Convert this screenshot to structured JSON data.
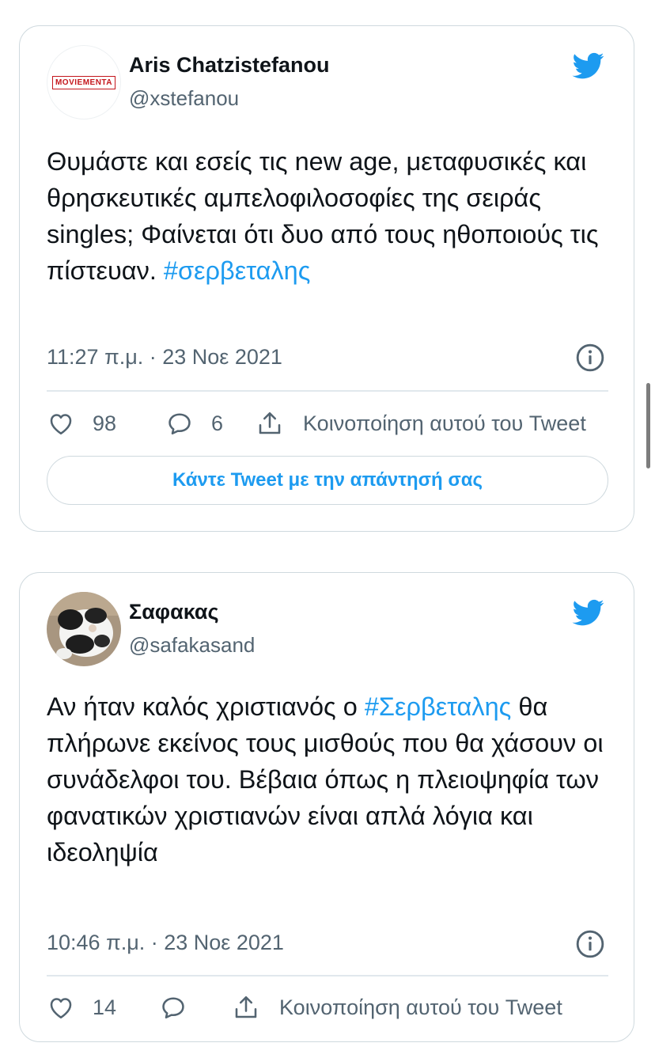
{
  "tweets": [
    {
      "author_name": "Aris Chatzistefanou",
      "handle": "@xstefanou",
      "avatar_logo_text": "MOVIEMENTA",
      "text_plain": "Θυμάστε και εσείς τις new age, μεταφυσικές και θρησκευτικές αμπελοφιλοσοφίες της σειράς singles; Φαίνεται ότι δυο από τους ηθοποιούς τις πίστευαν. ",
      "hashtag": "#σερβεταλης",
      "timestamp": "11:27 π.μ. · 23 Νοε 2021",
      "likes": "98",
      "replies": "6",
      "share_label": "Κοινοποίηση αυτού του Tweet",
      "reply_prompt": "Κάντε Tweet με την απάντησή σας"
    },
    {
      "author_name": "Σαφακας",
      "handle": "@safakasand",
      "text_plain_before": "Αν ήταν καλός χριστιανός ο ",
      "hashtag": "#Σερβεταλης",
      "text_plain_after": " θα πλήρωνε εκείνος τους μισθούς που θα χάσουν οι συνάδελφοι του. Βέβαια όπως η πλειοψηφία των φανατικών χριστιανών είναι απλά λόγια και ιδεοληψία",
      "timestamp": "10:46 π.μ. · 23 Νοε 2021",
      "likes": "14",
      "share_label": "Κοινοποίηση αυτού του Tweet"
    }
  ],
  "icons": {
    "brand": "twitter-bird-icon",
    "like": "heart-icon",
    "reply": "speech-bubble-icon",
    "share": "share-icon",
    "info": "info-icon"
  },
  "colors": {
    "accent": "#1d9bf0",
    "text": "#0f1419",
    "secondary_text": "#536471",
    "border": "#cfd9de"
  }
}
